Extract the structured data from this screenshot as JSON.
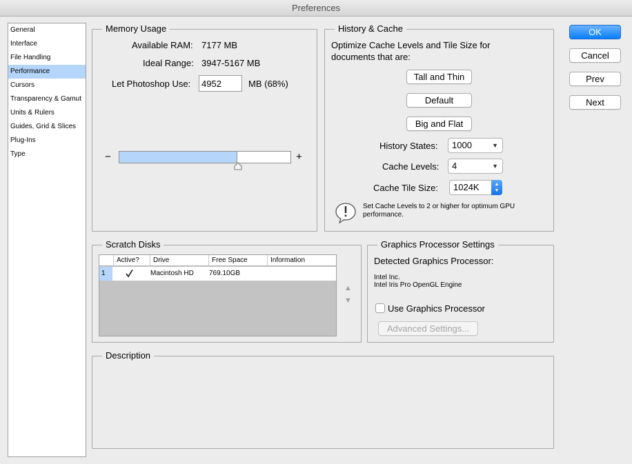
{
  "window": {
    "title": "Preferences"
  },
  "sidebar": {
    "items": [
      {
        "label": "General"
      },
      {
        "label": "Interface"
      },
      {
        "label": "File Handling"
      },
      {
        "label": "Performance",
        "selected": true
      },
      {
        "label": "Cursors"
      },
      {
        "label": "Transparency & Gamut"
      },
      {
        "label": "Units & Rulers"
      },
      {
        "label": "Guides, Grid & Slices"
      },
      {
        "label": "Plug-Ins"
      },
      {
        "label": "Type"
      }
    ]
  },
  "memory": {
    "title": "Memory Usage",
    "available_label": "Available RAM:",
    "available_value": "7177 MB",
    "ideal_label": "Ideal Range:",
    "ideal_value": "3947-5167 MB",
    "let_label": "Let Photoshop Use:",
    "let_value": "4952",
    "let_suffix": "MB (68%)",
    "slider_fraction": 0.69,
    "minus": "−",
    "plus": "+"
  },
  "history_cache": {
    "title": "History & Cache",
    "optimize_text_line1": "Optimize Cache Levels and Tile Size for",
    "optimize_text_line2": "documents that are:",
    "btn_tall": "Tall and Thin",
    "btn_default": "Default",
    "btn_big": "Big and Flat",
    "history_states_label": "History States:",
    "history_states_value": "1000",
    "cache_levels_label": "Cache Levels:",
    "cache_levels_value": "4",
    "cache_tile_label": "Cache Tile Size:",
    "cache_tile_value": "1024K",
    "note_line1": "Set Cache Levels to 2 or higher for optimum GPU",
    "note_line2": "performance."
  },
  "scratch": {
    "title": "Scratch Disks",
    "columns": [
      "Active?",
      "Drive",
      "Free Space",
      "Information"
    ],
    "rows": [
      {
        "index": "1",
        "active": true,
        "drive": "Macintosh HD",
        "free": "769.10GB",
        "info": ""
      }
    ]
  },
  "gpu": {
    "title": "Graphics Processor Settings",
    "detected_label": "Detected Graphics Processor:",
    "vendor": "Intel Inc.",
    "renderer": "Intel Iris Pro OpenGL Engine",
    "use_label": "Use Graphics Processor",
    "use_checked": false,
    "advanced_label": "Advanced Settings..."
  },
  "description": {
    "title": "Description"
  },
  "buttons": {
    "ok": "OK",
    "cancel": "Cancel",
    "prev": "Prev",
    "next": "Next"
  },
  "colors": {
    "accent": "#087eff",
    "selection": "#b5d5fb"
  }
}
